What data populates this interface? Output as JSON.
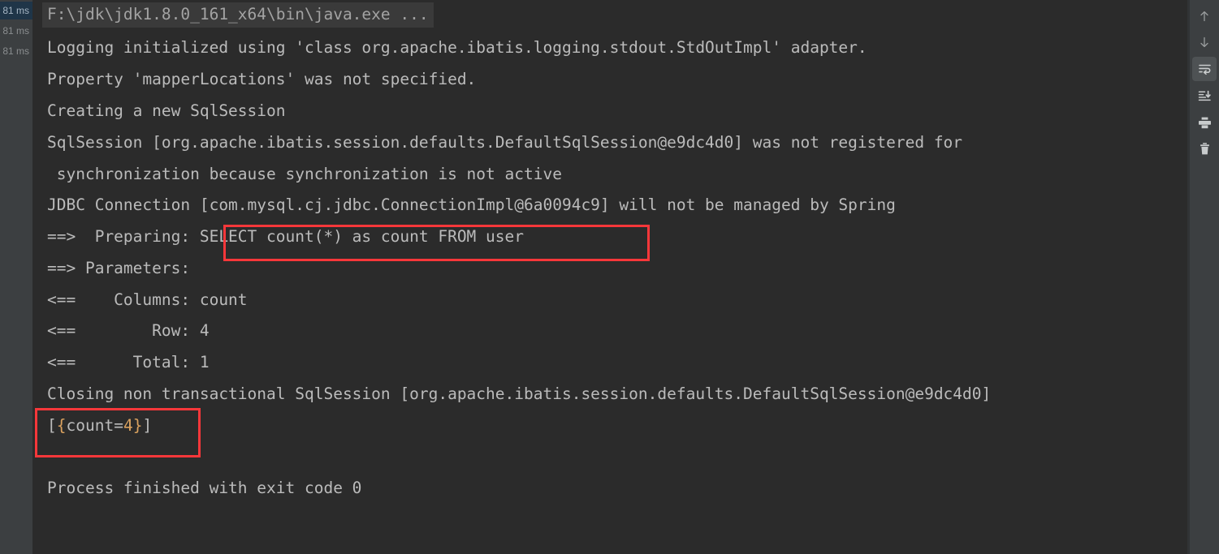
{
  "window": {
    "title": "Run console output"
  },
  "colors": {
    "console_bg": "#2b2b2b",
    "gutter_bg": "#3c3f41",
    "toolbar_bg": "#3c3f41",
    "text": "#bbbbbb",
    "command_text": "#a3a3a3",
    "command_bg": "#3a3a3a",
    "annotation_red": "#f8373a",
    "selected_row_bg": "#1f3548",
    "number_orange": "#d9a15f"
  },
  "gutter": {
    "rows": [
      {
        "label": "81 ms",
        "selected": true
      },
      {
        "label": "81 ms",
        "selected": false
      },
      {
        "label": "81 ms",
        "selected": false
      }
    ]
  },
  "console": {
    "command_line": "F:\\jdk\\jdk1.8.0_161_x64\\bin\\java.exe ...",
    "lines": [
      "Logging initialized using 'class org.apache.ibatis.logging.stdout.StdOutImpl' adapter.",
      "Property 'mapperLocations' was not specified.",
      "Creating a new SqlSession",
      "SqlSession [org.apache.ibatis.session.defaults.DefaultSqlSession@e9dc4d0] was not registered for",
      " synchronization because synchronization is not active",
      "JDBC Connection [com.mysql.cj.jdbc.ConnectionImpl@6a0094c9] will not be managed by Spring",
      "==>  Preparing: SELECT count(*) as count FROM user",
      "==> Parameters:",
      "<==    Columns: count",
      "<==        Row: 4",
      "<==      Total: 1",
      "Closing non transactional SqlSession [org.apache.ibatis.session.defaults.DefaultSqlSession@e9dc4d0]",
      "[{count=4}]",
      "",
      "Process finished with exit code 0"
    ],
    "result": {
      "sql_statement": "SELECT count(*) as count FROM user",
      "returned_value": "[{count=4}]",
      "columns": "count",
      "row": "4",
      "total": "1",
      "exit_code": "0"
    }
  },
  "annotations": [
    {
      "name": "sql-statement-highlight",
      "target": "SELECT count(*) as count FROM user"
    },
    {
      "name": "result-value-highlight",
      "target": "[{count=4}]"
    }
  ],
  "toolbar": {
    "buttons": [
      {
        "name": "scroll-up-button",
        "icon": "arrow-up-icon",
        "label": "Up",
        "active": false
      },
      {
        "name": "scroll-down-button",
        "icon": "arrow-down-icon",
        "label": "Down",
        "active": false
      },
      {
        "name": "soft-wrap-button",
        "icon": "soft-wrap-icon",
        "label": "Soft-Wrap",
        "active": true
      },
      {
        "name": "scroll-to-end-button",
        "icon": "scroll-to-end-icon",
        "label": "Scroll to End",
        "active": false
      },
      {
        "name": "print-button",
        "icon": "printer-icon",
        "label": "Print",
        "active": false
      },
      {
        "name": "clear-all-button",
        "icon": "trash-icon",
        "label": "Clear All",
        "active": false
      }
    ]
  }
}
